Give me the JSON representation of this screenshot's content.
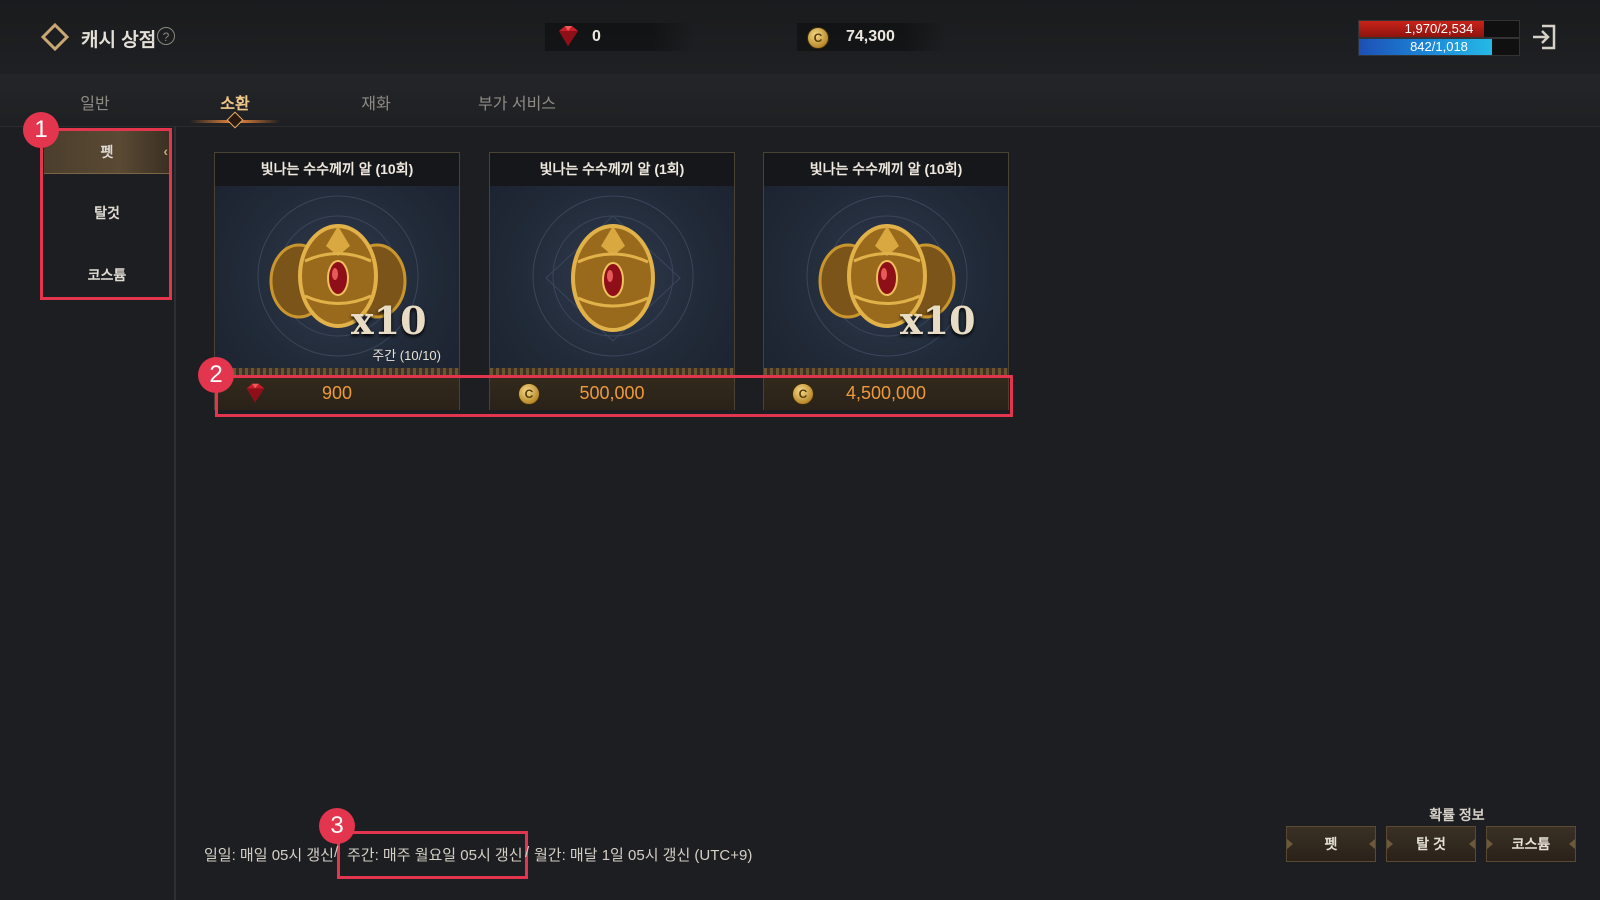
{
  "header": {
    "title": "캐시 상점",
    "help_label": "?",
    "gems": "0",
    "gold": "74,300",
    "hp_text": "1,970/2,534",
    "hp_fraction": 0.78,
    "mp_text": "842/1,018",
    "mp_fraction": 0.83
  },
  "tabs": [
    {
      "label": "일반"
    },
    {
      "label": "소환"
    },
    {
      "label": "재화"
    },
    {
      "label": "부가 서비스"
    }
  ],
  "active_tab": "소환",
  "sidebar": {
    "items": [
      {
        "label": "펫"
      },
      {
        "label": "탈것"
      },
      {
        "label": "코스튬"
      }
    ],
    "active": "펫"
  },
  "cards": [
    {
      "title": "빛나는 수수께끼 알 (10회)",
      "multiplier": "x10",
      "limit": "주간 (10/10)",
      "currency": "gem",
      "price": "900"
    },
    {
      "title": "빛나는 수수께끼 알 (1회)",
      "multiplier": "",
      "limit": "",
      "currency": "gold",
      "price": "500,000"
    },
    {
      "title": "빛나는 수수께끼 알 (10회)",
      "multiplier": "x10",
      "limit": "",
      "currency": "gold",
      "price": "4,500,000"
    }
  ],
  "annotations": [
    "1",
    "2",
    "3"
  ],
  "footer": {
    "daily": "일일: 매일 05시 갱신",
    "sep1": "/",
    "weekly": "주간: 매주 월요일 05시 갱신",
    "sep2": "/",
    "monthly": "월간: 매달 1일 05시 갱신 (UTC+9)"
  },
  "probability": {
    "title": "확률 정보",
    "buttons": [
      "펫",
      "탈 것",
      "코스튬"
    ]
  },
  "colors": {
    "accent_orange": "#ef9a3a",
    "annotation_red": "#e3354e",
    "active_tab": "#f0c98a"
  },
  "icons": [
    "back-diamond-icon",
    "help-icon",
    "ruby-icon",
    "gold-coin-icon",
    "exit-icon",
    "egg-icon"
  ]
}
